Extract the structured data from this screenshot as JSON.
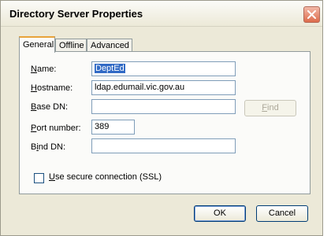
{
  "window": {
    "title": "Directory Server Properties",
    "close_icon": "close-icon"
  },
  "tabs": [
    {
      "label": "General",
      "active": true
    },
    {
      "label": "Offline",
      "active": false
    },
    {
      "label": "Advanced",
      "active": false
    }
  ],
  "form": {
    "name_label_underlined": "N",
    "name_label_rest": "ame:",
    "name_value": "DeptEd",
    "hostname_label_underlined": "H",
    "hostname_label_rest": "ostname:",
    "hostname_value": "ldap.edumail.vic.gov.au",
    "basedn_label_underlined": "B",
    "basedn_label_rest": "ase DN:",
    "basedn_value": "",
    "find_label_underlined": "F",
    "find_label_rest": "ind",
    "port_label_underlined": "P",
    "port_label_rest": "ort number:",
    "port_value": "389",
    "binddn_label_prefix": "B",
    "binddn_label_underlined": "i",
    "binddn_label_rest": "nd DN:",
    "binddn_value": "",
    "ssl_label_underlined": "U",
    "ssl_label_rest": "se secure connection (SSL)",
    "ssl_checked": false
  },
  "buttons": {
    "ok": "OK",
    "cancel": "Cancel"
  }
}
